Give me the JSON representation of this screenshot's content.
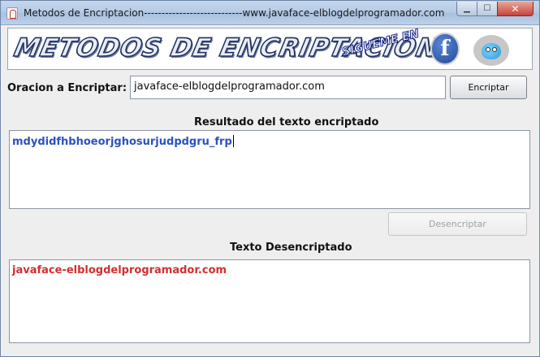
{
  "window": {
    "title": "Metodos de Encriptacion----------------------------www.javaface-elblogdelprogramador.com"
  },
  "banner": {
    "title": "METODOS DE ENCRIPTACION",
    "sigueme": "SIGUEME EN",
    "facebook_letter": "f"
  },
  "input": {
    "label": "Oracion a Encriptar:",
    "value": "javaface-elblogdelprogramador.com",
    "encrypt_button": "Encriptar"
  },
  "encrypted": {
    "heading": "Resultado del texto encriptado",
    "text": "mdydidfhbhoeorjghosurjudpdgru_frp",
    "text_color": "#2a52c2",
    "decrypt_button": "Desencriptar"
  },
  "decrypted": {
    "heading": "Texto Desencriptado",
    "text": "javaface-elblogdelprogramador.com",
    "text_color": "#d32f2f"
  }
}
